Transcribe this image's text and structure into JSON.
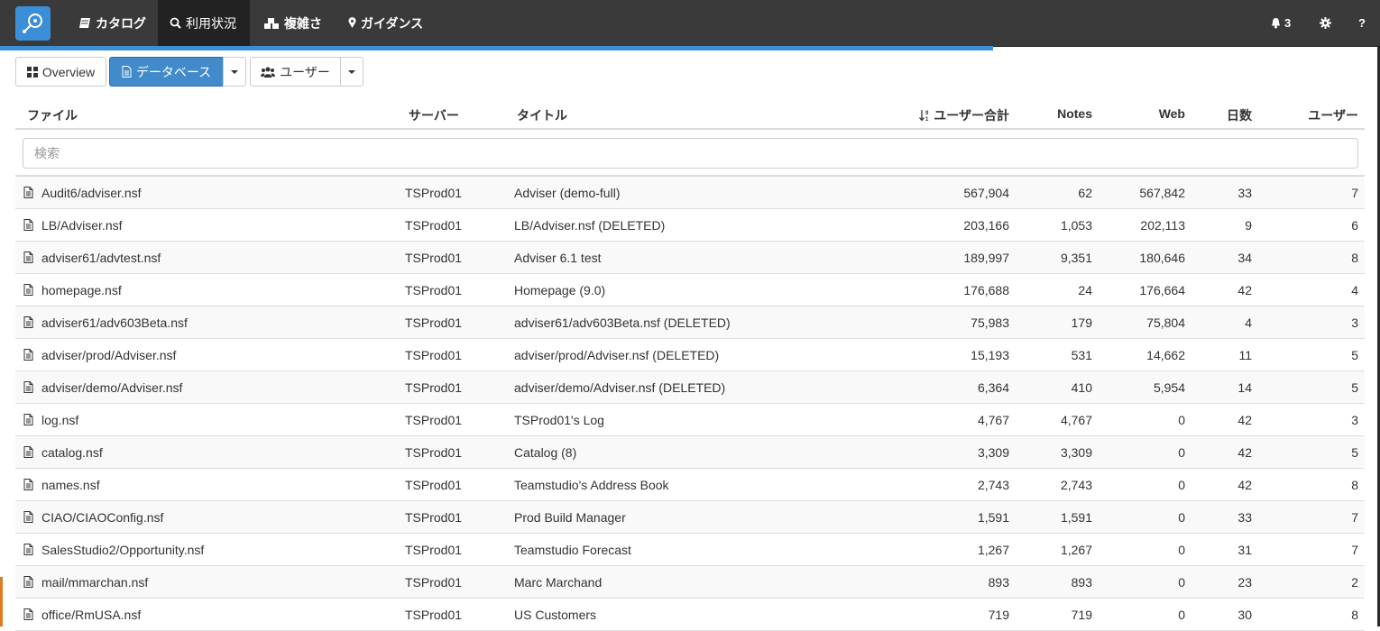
{
  "nav": {
    "items": [
      {
        "label": "カタログ",
        "icon": "book-icon"
      },
      {
        "label": "利用状況",
        "icon": "search-icon"
      },
      {
        "label": "複雑さ",
        "icon": "cubes-icon"
      },
      {
        "label": "ガイダンス",
        "icon": "map-marker-icon"
      }
    ],
    "active_index": 1,
    "notifications": "3",
    "help": "?"
  },
  "colors": {
    "navbar": "#3a3a3a",
    "accent": "#428bca",
    "progress": "#3b8ed8"
  },
  "progress_fraction": 0.72,
  "toolbar": {
    "overview_label": "Overview",
    "database_label": "データベース",
    "users_label": "ユーザー"
  },
  "table": {
    "headers": {
      "file": "ファイル",
      "server": "サーバー",
      "title": "タイトル",
      "user_total": "ユーザー合計",
      "notes": "Notes",
      "web": "Web",
      "days": "日数",
      "users": "ユーザー"
    },
    "search_placeholder": "検索",
    "rows": [
      {
        "file": "Audit6/adviser.nsf",
        "server": "TSProd01",
        "title": "Adviser (demo-full)",
        "user_total": "567,904",
        "notes": "62",
        "web": "567,842",
        "days": "33",
        "users": "7"
      },
      {
        "file": "LB/Adviser.nsf",
        "server": "TSProd01",
        "title": "LB/Adviser.nsf (DELETED)",
        "user_total": "203,166",
        "notes": "1,053",
        "web": "202,113",
        "days": "9",
        "users": "6"
      },
      {
        "file": "adviser61/advtest.nsf",
        "server": "TSProd01",
        "title": "Adviser 6.1 test",
        "user_total": "189,997",
        "notes": "9,351",
        "web": "180,646",
        "days": "34",
        "users": "8"
      },
      {
        "file": "homepage.nsf",
        "server": "TSProd01",
        "title": "Homepage (9.0)",
        "user_total": "176,688",
        "notes": "24",
        "web": "176,664",
        "days": "42",
        "users": "4"
      },
      {
        "file": "adviser61/adv603Beta.nsf",
        "server": "TSProd01",
        "title": "adviser61/adv603Beta.nsf (DELETED)",
        "user_total": "75,983",
        "notes": "179",
        "web": "75,804",
        "days": "4",
        "users": "3"
      },
      {
        "file": "adviser/prod/Adviser.nsf",
        "server": "TSProd01",
        "title": "adviser/prod/Adviser.nsf (DELETED)",
        "user_total": "15,193",
        "notes": "531",
        "web": "14,662",
        "days": "11",
        "users": "5"
      },
      {
        "file": "adviser/demo/Adviser.nsf",
        "server": "TSProd01",
        "title": "adviser/demo/Adviser.nsf (DELETED)",
        "user_total": "6,364",
        "notes": "410",
        "web": "5,954",
        "days": "14",
        "users": "5"
      },
      {
        "file": "log.nsf",
        "server": "TSProd01",
        "title": "TSProd01's Log",
        "user_total": "4,767",
        "notes": "4,767",
        "web": "0",
        "days": "42",
        "users": "3"
      },
      {
        "file": "catalog.nsf",
        "server": "TSProd01",
        "title": "Catalog (8)",
        "user_total": "3,309",
        "notes": "3,309",
        "web": "0",
        "days": "42",
        "users": "5"
      },
      {
        "file": "names.nsf",
        "server": "TSProd01",
        "title": "Teamstudio's Address Book",
        "user_total": "2,743",
        "notes": "2,743",
        "web": "0",
        "days": "42",
        "users": "8"
      },
      {
        "file": "CIAO/CIAOConfig.nsf",
        "server": "TSProd01",
        "title": "Prod Build Manager",
        "user_total": "1,591",
        "notes": "1,591",
        "web": "0",
        "days": "33",
        "users": "7"
      },
      {
        "file": "SalesStudio2/Opportunity.nsf",
        "server": "TSProd01",
        "title": "Teamstudio Forecast",
        "user_total": "1,267",
        "notes": "1,267",
        "web": "0",
        "days": "31",
        "users": "7"
      },
      {
        "file": "mail/mmarchan.nsf",
        "server": "TSProd01",
        "title": "Marc Marchand",
        "user_total": "893",
        "notes": "893",
        "web": "0",
        "days": "23",
        "users": "2"
      },
      {
        "file": "office/RmUSA.nsf",
        "server": "TSProd01",
        "title": "US Customers",
        "user_total": "719",
        "notes": "719",
        "web": "0",
        "days": "30",
        "users": "8"
      }
    ]
  }
}
